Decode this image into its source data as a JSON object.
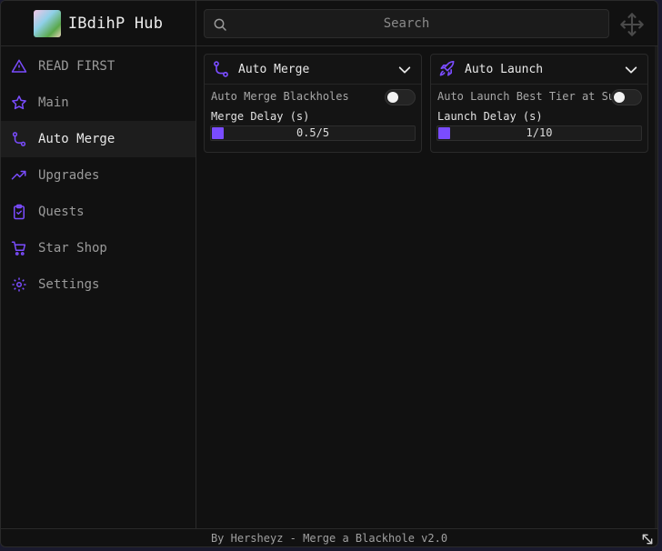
{
  "app": {
    "title": "IBdihP Hub",
    "accent": "#7a4cff"
  },
  "sidebar": {
    "items": [
      {
        "label": "READ FIRST",
        "icon": "warning-icon",
        "active": false
      },
      {
        "label": "Main",
        "icon": "star-icon",
        "active": false
      },
      {
        "label": "Auto Merge",
        "icon": "route-icon",
        "active": true
      },
      {
        "label": "Upgrades",
        "icon": "trending-up-icon",
        "active": false
      },
      {
        "label": "Quests",
        "icon": "clipboard-check-icon",
        "active": false
      },
      {
        "label": "Star Shop",
        "icon": "cart-icon",
        "active": false
      },
      {
        "label": "Settings",
        "icon": "gear-icon",
        "active": false
      }
    ]
  },
  "search": {
    "placeholder": "Search",
    "value": ""
  },
  "cards": [
    {
      "title": "Auto Merge",
      "icon": "route-icon",
      "toggle_label": "Auto Merge Blackholes",
      "toggle_on": false,
      "slider_label": "Merge Delay (s)",
      "slider_value": "0.5/5"
    },
    {
      "title": "Auto Launch",
      "icon": "rocket-icon",
      "toggle_label": "Auto Launch Best Tier at Sun",
      "toggle_on": false,
      "slider_label": "Launch Delay (s)",
      "slider_value": "1/10"
    }
  ],
  "footer": {
    "text": "By Hersheyz - Merge a Blackhole v2.0"
  }
}
